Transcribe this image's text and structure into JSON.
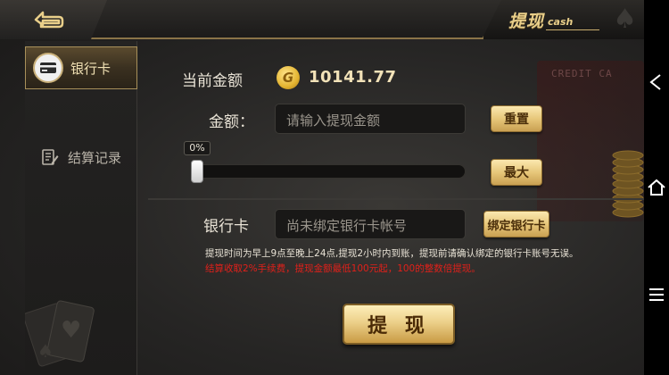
{
  "header": {
    "title_cn": "提现",
    "title_en": "cash",
    "icons": {
      "back": "back-arrow-icon",
      "deco": "spade-icon"
    }
  },
  "sidebar": {
    "items": [
      {
        "label": "银行卡",
        "icon": "bank-card-icon",
        "active": true
      },
      {
        "label": "结算记录",
        "icon": "ledger-edit-icon",
        "active": false
      }
    ]
  },
  "withdraw": {
    "balance_label": "当前金额",
    "balance_coin_glyph": "G",
    "balance_value": "10141.77",
    "amount_label": "金额：",
    "amount_placeholder": "请输入提现金额",
    "reset_label": "重置",
    "slider_percent_label": "0%",
    "slider_value": 0,
    "max_label": "最大",
    "bank_label": "银行卡",
    "bank_placeholder": "尚未绑定银行卡帐号",
    "bind_label": "绑定银行卡",
    "note_info": "提现时间为早上9点至晚上24点,提现2小时内到账，提现前请确认绑定的银行卡账号无误。",
    "note_fee": "结算收取2%手续费，提现金额最低100元起，100的整数倍提现。",
    "submit_label": "提 现",
    "decor_card_text": "CREDIT CA"
  },
  "colors": {
    "accent_gold": "#e9cf8a",
    "button_gold": "#e7c77a",
    "warning_red": "#e0201a",
    "background": "#262524"
  },
  "navbar": {
    "icons": [
      "nav-back-icon",
      "nav-home-icon",
      "nav-menu-icon"
    ]
  }
}
